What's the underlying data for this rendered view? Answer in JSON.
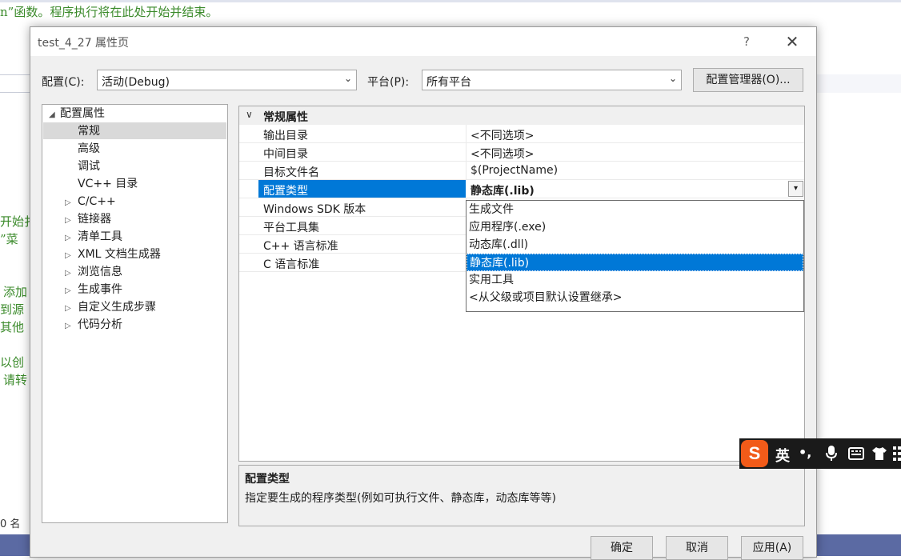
{
  "background": {
    "code_lines": [
      "n”函数。程序执行将在此处开始并结束。",
      "开始扌",
      "”菜",
      "添加",
      "到源",
      "其他",
      "以创",
      "请转"
    ],
    "status_text": "0 名"
  },
  "dialog": {
    "title": "test_4_27 属性页",
    "help_label": "?",
    "close_label": "✕",
    "config_label": "配置(C):",
    "config_value": "活动(Debug)",
    "platform_label": "平台(P):",
    "platform_value": "所有平台",
    "config_manager_label": "配置管理器(O)...",
    "ok_label": "确定",
    "cancel_label": "取消",
    "apply_label": "应用(A)"
  },
  "tree": {
    "root": "配置属性",
    "items": [
      {
        "label": "常规",
        "selected": true
      },
      {
        "label": "高级"
      },
      {
        "label": "调试"
      },
      {
        "label": "VC++ 目录"
      },
      {
        "label": "C/C++"
      },
      {
        "label": "链接器"
      },
      {
        "label": "清单工具"
      },
      {
        "label": "XML 文档生成器"
      },
      {
        "label": "浏览信息"
      },
      {
        "label": "生成事件"
      },
      {
        "label": "自定义生成步骤"
      },
      {
        "label": "代码分析"
      }
    ]
  },
  "grid": {
    "section": "常规属性",
    "rows": [
      {
        "name": "输出目录",
        "value": "<不同选项>"
      },
      {
        "name": "中间目录",
        "value": "<不同选项>"
      },
      {
        "name": "目标文件名",
        "value": "$(ProjectName)"
      },
      {
        "name": "配置类型",
        "value": "静态库(.lib)",
        "selected": true
      },
      {
        "name": "Windows SDK 版本",
        "value": ""
      },
      {
        "name": "平台工具集",
        "value": ""
      },
      {
        "name": "C++ 语言标准",
        "value": ""
      },
      {
        "name": "C 语言标准",
        "value": ""
      }
    ],
    "dropdown_options": [
      "生成文件",
      "应用程序(.exe)",
      "动态库(.dll)",
      "静态库(.lib)",
      "实用工具",
      "<从父级或项目默认设置继承>"
    ],
    "dropdown_selected_index": 3
  },
  "description": {
    "title": "配置类型",
    "body": "指定要生成的程序类型(例如可执行文件、静态库，动态库等等)"
  },
  "ime": {
    "logo": "S",
    "mode": "英",
    "punct": "•,",
    "icons": [
      "mic-icon",
      "keyboard-icon",
      "skin-icon",
      "grid-icon"
    ]
  },
  "colors": {
    "selection": "#0078d7",
    "accent_ime": "#f25b19"
  }
}
